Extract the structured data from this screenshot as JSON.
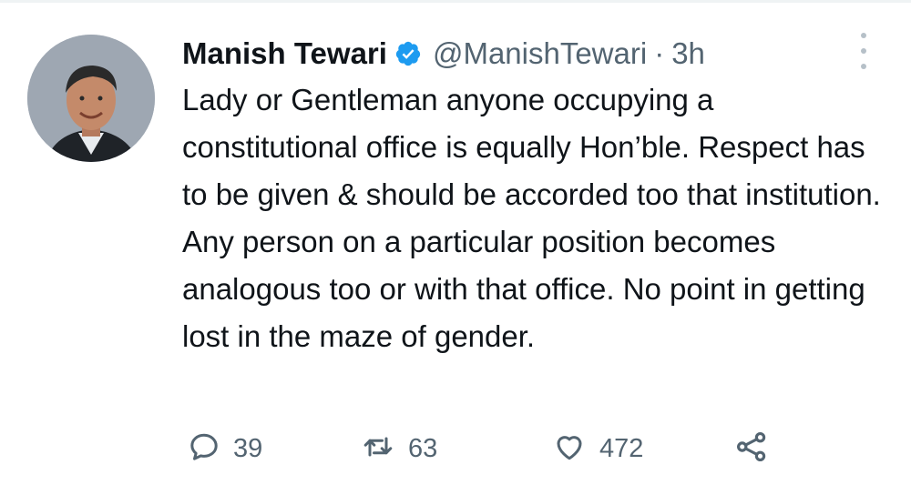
{
  "tweet": {
    "author": {
      "name": "Manish Tewari",
      "handle": "@ManishTewari",
      "verified": true
    },
    "separator": "·",
    "time": "3h",
    "text": "Lady or Gentleman anyone occupying a constitutional office is equally Hon’ble. Respect has to be given & should be accorded too that institution. Any person on a particular position becomes analogous too or with that office. No point in getting lost in the maze of gender.",
    "stats": {
      "replies": "39",
      "retweets": "63",
      "likes": "472"
    }
  },
  "icons": {
    "verified": "verified-badge-icon",
    "more": "more-vertical-icon",
    "reply": "reply-bubble-icon",
    "retweet": "retweet-icon",
    "like": "heart-icon",
    "share": "share-icon"
  },
  "colors": {
    "text": "#0f1419",
    "secondary": "#536471",
    "verified": "#1d9bf0",
    "more_dots": "#b6c0c8"
  }
}
